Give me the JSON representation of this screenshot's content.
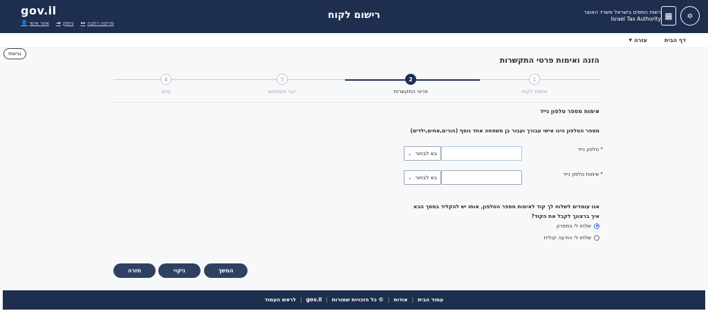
{
  "header": {
    "logo": "gov.il",
    "title": "רישום לקוח",
    "authority_he": "רשות המסים בישראל משרד האוצר",
    "authority_en": "Israel Tax Authority",
    "links": [
      {
        "label": "אזור אישי",
        "icon": "user-icon"
      },
      {
        "label": "ניתוק",
        "icon": "logout-icon"
      },
      {
        "label": "פריסה רחבה",
        "icon": "expand-icon"
      }
    ]
  },
  "nav": {
    "home": "דף הבית",
    "help": "עזרה"
  },
  "accessibility": "נגישות",
  "page": {
    "section_title": "הזנה ואימות פרטי התקשרות",
    "steps": [
      {
        "number": "1",
        "label": "אימות לקוח",
        "state": "done"
      },
      {
        "number": "2",
        "label": "פרטי התקשרות",
        "state": "active"
      },
      {
        "number": "3",
        "label": "קוד משתמש",
        "state": "todo"
      },
      {
        "number": "4",
        "label": "סיום",
        "state": "todo"
      }
    ],
    "sub_title": "אימות מספר טלפון נייד",
    "note": "מספר הטלפון הינו אישי עבורך ועבור בן משפחה אחד נוסף (הורים,אחים,ילדים)",
    "fields": {
      "phone": {
        "label": "טלפון נייד",
        "value": "",
        "prefix": "בא לבחור"
      },
      "phone_confirm": {
        "label": "אימות טלפון נייד",
        "value": "",
        "prefix": "בא לבחור"
      }
    },
    "info_1": "אנו עומדים לשלוח לך קוד לאימות מספר הטלפון, אותו יש להקליד במסך הבא",
    "info_2": "איך ברצונך לקבל את הקוד?",
    "radio_options": [
      {
        "label": "שלחו לי במסרון",
        "checked": true
      },
      {
        "label": "שלחו לי הודעה קולית",
        "checked": false
      }
    ],
    "buttons": {
      "continue": "המשך",
      "clear": "ניקוי",
      "back": "חזרה"
    }
  },
  "footer": {
    "links": [
      "עמוד הבית",
      "אודות",
      "© כל הזכויות שמורות",
      "gov.il",
      "לראש העמוד"
    ]
  }
}
